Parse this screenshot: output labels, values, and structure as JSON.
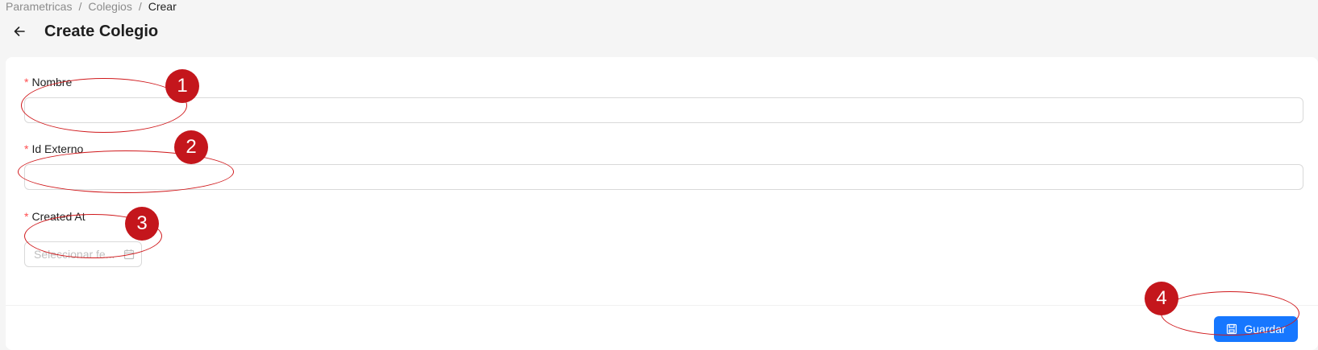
{
  "breadcrumb": {
    "items": [
      "Parametricas",
      "Colegios",
      "Crear"
    ],
    "separator": "/"
  },
  "header": {
    "back_icon": "arrow-left-icon",
    "title": "Create Colegio"
  },
  "form": {
    "required_marker": "*",
    "fields": {
      "nombre": {
        "label": "Nombre",
        "value": ""
      },
      "id_externo": {
        "label": "Id Externo",
        "value": ""
      },
      "created_at": {
        "label": "Created At",
        "placeholder": "Seleccionar fe...",
        "icon": "calendar-icon"
      }
    }
  },
  "footer": {
    "save_label": "Guardar",
    "save_icon": "save-icon"
  },
  "annotations": [
    "1",
    "2",
    "3",
    "4"
  ],
  "colors": {
    "primary": "#1677ff",
    "required": "#ff4d4f",
    "annotation": "#c4161c"
  }
}
